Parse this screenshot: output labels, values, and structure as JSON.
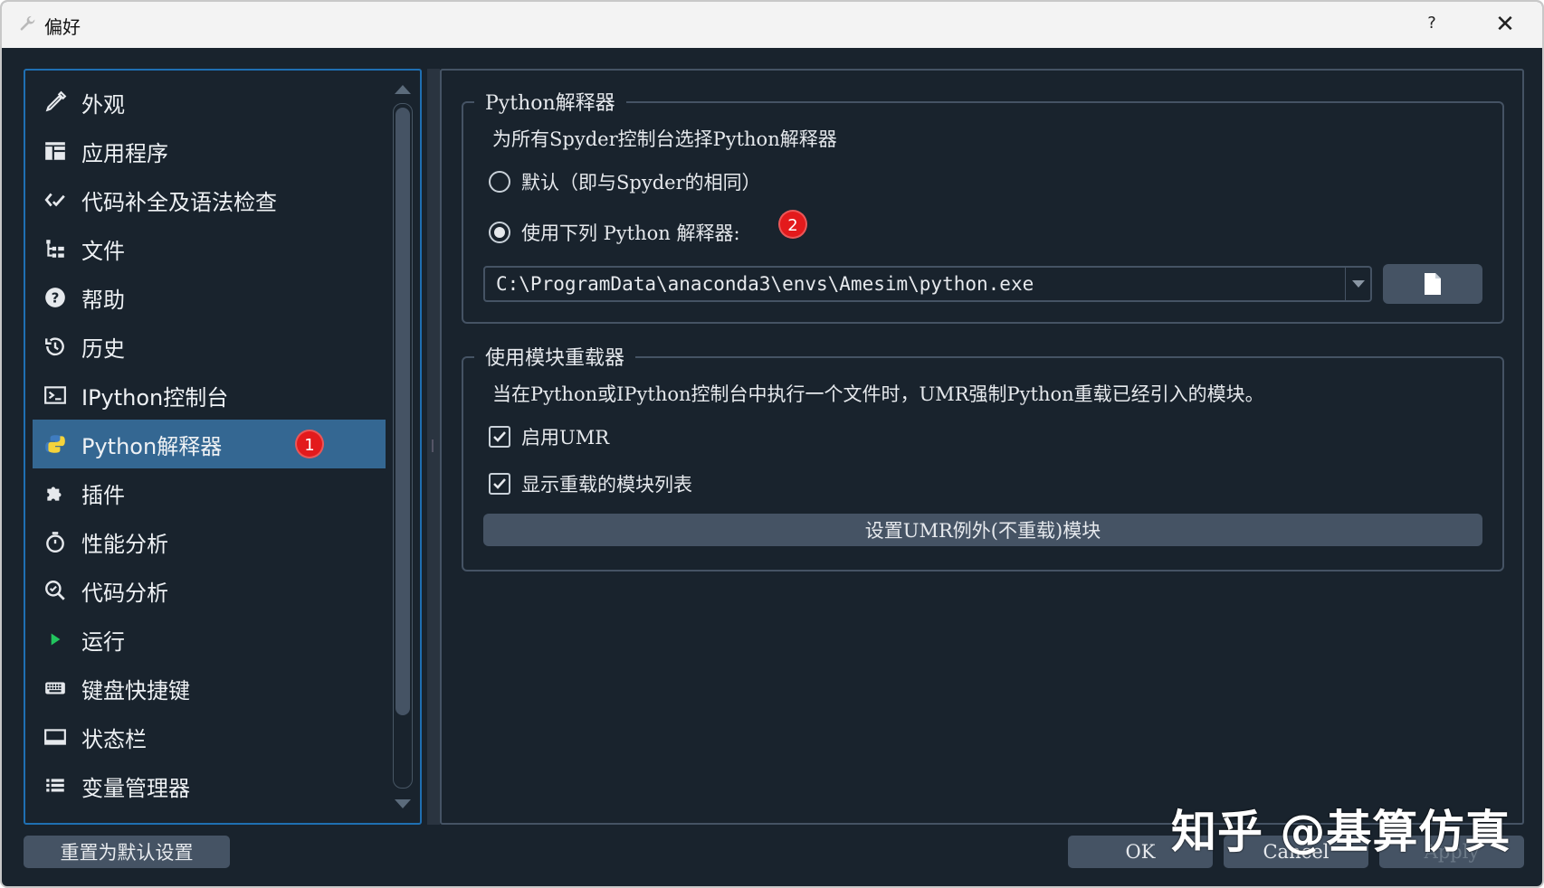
{
  "window": {
    "title": "偏好",
    "help_label": "?",
    "close_label": "✕"
  },
  "sidebar": {
    "items": [
      {
        "label": "外观",
        "icon": "brush-icon"
      },
      {
        "label": "应用程序",
        "icon": "layout-icon"
      },
      {
        "label": "代码补全及语法检查",
        "icon": "code-check-icon"
      },
      {
        "label": "文件",
        "icon": "file-tree-icon"
      },
      {
        "label": "帮助",
        "icon": "help-circle-icon"
      },
      {
        "label": "历史",
        "icon": "history-icon"
      },
      {
        "label": "IPython控制台",
        "icon": "terminal-icon"
      },
      {
        "label": "Python解释器",
        "icon": "python-icon",
        "selected": true
      },
      {
        "label": "插件",
        "icon": "puzzle-icon"
      },
      {
        "label": "性能分析",
        "icon": "stopwatch-icon"
      },
      {
        "label": "代码分析",
        "icon": "search-code-icon"
      },
      {
        "label": "运行",
        "icon": "play-icon"
      },
      {
        "label": "键盘快捷键",
        "icon": "keyboard-icon"
      },
      {
        "label": "状态栏",
        "icon": "statusbar-icon"
      },
      {
        "label": "变量管理器",
        "icon": "list-icon"
      }
    ],
    "marker_selected": "1"
  },
  "interpreter_group": {
    "title": "Python解释器",
    "description": "为所有Spyder控制台选择Python解释器",
    "option_default": "默认（即与Spyder的相同）",
    "option_custom": "使用下列 Python 解释器:",
    "marker": "2",
    "selected_option": "custom",
    "path_value": "C:\\ProgramData\\anaconda3\\envs\\Amesim\\python.exe"
  },
  "umr_group": {
    "title": "使用模块重载器",
    "description": "当在Python或IPython控制台中执行一个文件时，UMR强制Python重载已经引入的模块。",
    "enable_umr": "启用UMR",
    "enable_umr_checked": true,
    "show_list": "显示重载的模块列表",
    "show_list_checked": true,
    "exceptions_button": "设置UMR例外(不重载)模块"
  },
  "footer": {
    "reset_label": "重置为默认设置",
    "ok_label": "OK",
    "cancel_label": "Cancel",
    "apply_label": "Apply",
    "watermark": "知乎 @基算仿真"
  },
  "colors": {
    "background": "#19232d",
    "selection": "#346792",
    "border": "#455364",
    "marker": "#e31a1c"
  }
}
